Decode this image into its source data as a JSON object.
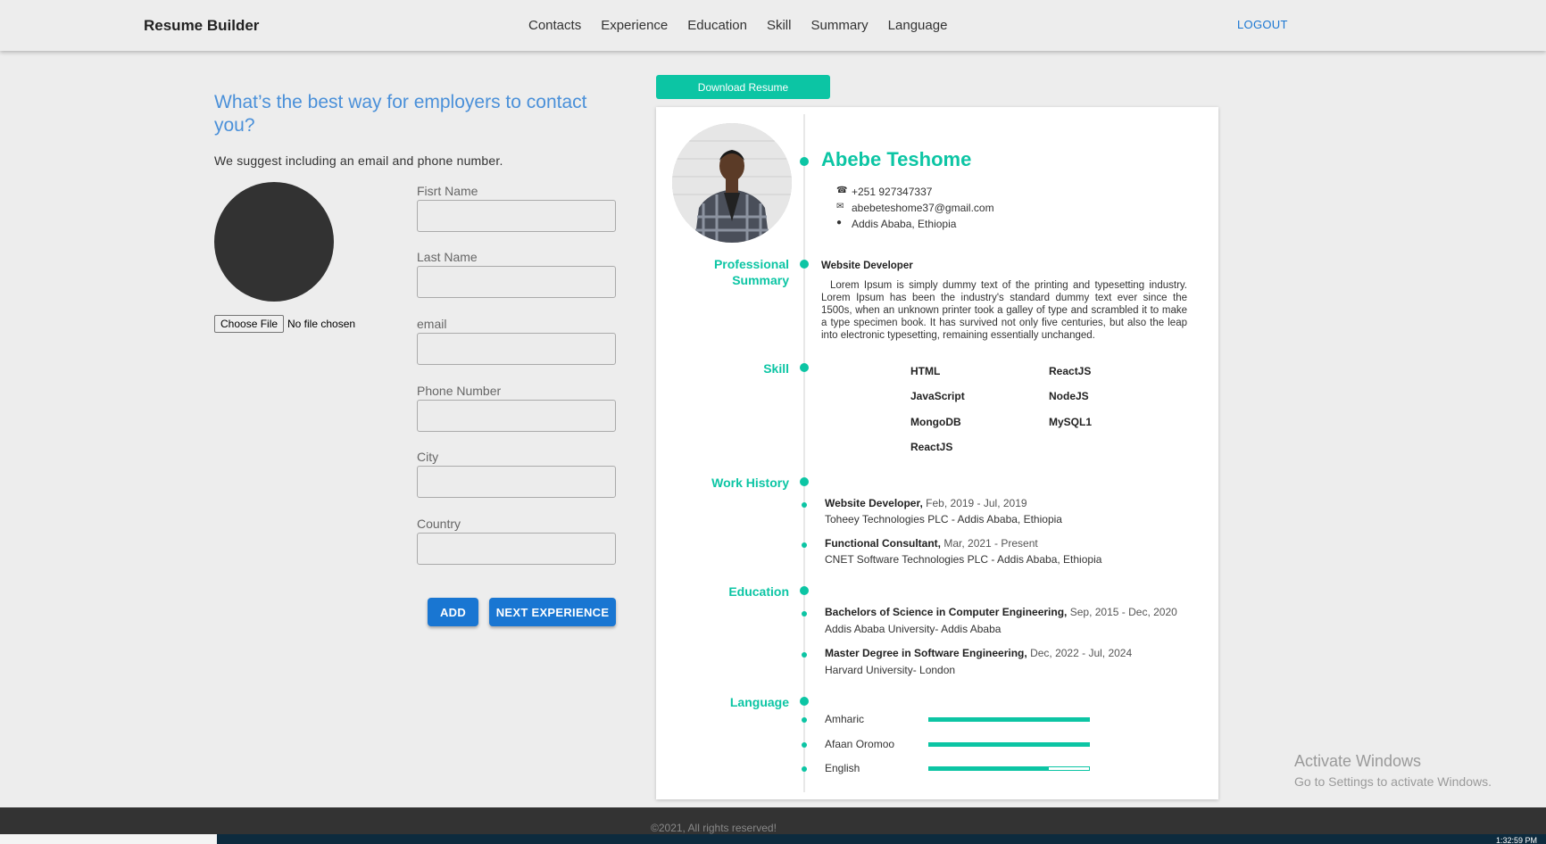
{
  "header": {
    "brand": "Resume Builder",
    "nav": [
      "Contacts",
      "Experience",
      "Education",
      "Skill",
      "Summary",
      "Language"
    ],
    "logout": "LOGOUT"
  },
  "form": {
    "title": "What’s the best way for employers to contact you?",
    "subtitle": "We suggest including an email and phone number.",
    "file_button": "Choose File",
    "file_status": "No file chosen",
    "fields": {
      "first_name": "Fisrt Name",
      "last_name": "Last Name",
      "email": "email",
      "phone": "Phone Number",
      "city": "City",
      "country": "Country"
    },
    "values": {
      "first_name": "",
      "last_name": "",
      "email": "",
      "phone": "",
      "city": "",
      "country": ""
    },
    "add_button": "ADD",
    "next_button": "NEXT EXPERIENCE"
  },
  "resume": {
    "download_button": "Download Resume",
    "name": "Abebe Teshome",
    "phone": "+251 927347337",
    "email": "abebeteshome37@gmail.com",
    "location": "Addis Ababa, Ethiopia",
    "sections": {
      "summary": "Professional Summary",
      "skill": "Skill",
      "work": "Work History",
      "education": "Education",
      "language": "Language"
    },
    "job_title": "Website Developer",
    "summary": "Lorem Ipsum is simply dummy text of the printing and typesetting industry. Lorem Ipsum has been the industry's standard dummy text ever since the 1500s, when an unknown printer took a galley of type and scrambled it to make a type specimen book. It has survived not only five centuries, but also the leap into electronic typesetting, remaining essentially unchanged.",
    "skills": [
      "HTML",
      "ReactJS",
      "JavaScript",
      "NodeJS",
      "MongoDB",
      "MySQL1",
      "ReactJS"
    ],
    "work": [
      {
        "title": "Website Developer,",
        "dates": "Feb, 2019 - Jul, 2019",
        "company": "Toheey Technologies PLC - Addis Ababa, Ethiopia"
      },
      {
        "title": "Functional Consultant,",
        "dates": "Mar, 2021 - Present",
        "company": "CNET Software Technologies PLC - Addis Ababa, Ethiopia"
      }
    ],
    "education": [
      {
        "degree": "Bachelors of Science in Computer Engineering,",
        "dates": "Sep, 2015 - Dec, 2020",
        "school": "Addis Ababa University- Addis Ababa"
      },
      {
        "degree": "Master Degree in Software Engineering,",
        "dates": "Dec, 2022 - Jul, 2024",
        "school": "Harvard University- London"
      }
    ],
    "languages": [
      {
        "name": "Amharic",
        "level": 1.0
      },
      {
        "name": "Afaan Oromoo",
        "level": 1.0
      },
      {
        "name": "English",
        "level": 0.75
      }
    ],
    "accent_color": "#0cc5a4"
  },
  "footer": {
    "copyright": "©2021, All rights reserved!"
  },
  "watermark": {
    "line1": "Activate Windows",
    "line2": "Go to Settings to activate Windows."
  },
  "taskbar": {
    "clock": "1:32:59 PM"
  }
}
